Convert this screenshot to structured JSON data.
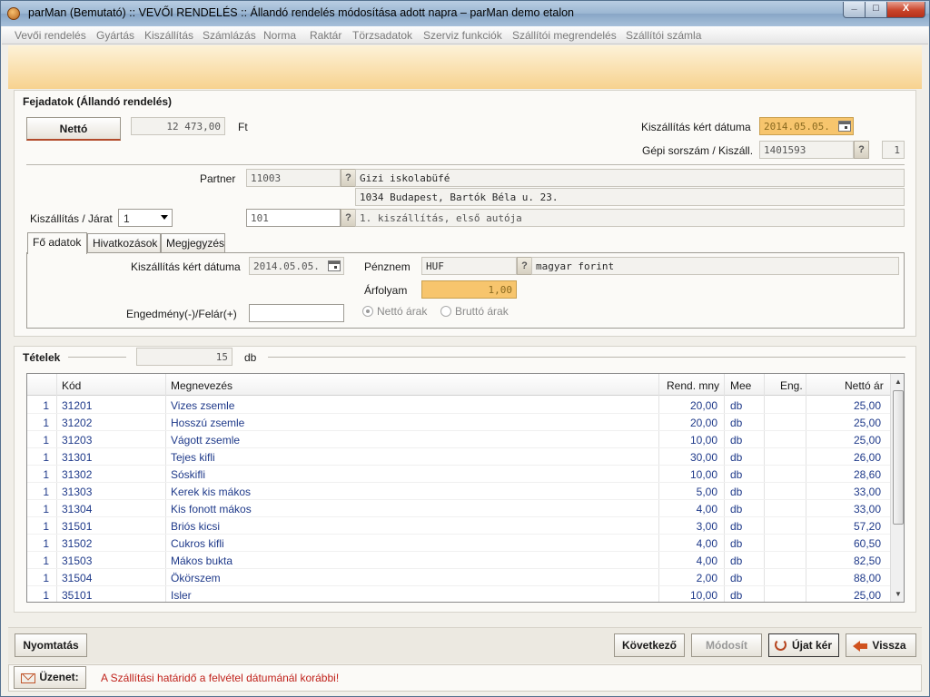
{
  "window": {
    "title": "parMan (Bemutató) :: VEVŐI RENDELÉS :: Állandó rendelés módosítása adott napra   –   parMan demo etalon",
    "min_glyph": "_",
    "max_glyph": "□",
    "close_glyph": "X"
  },
  "menu": [
    "Vevői rendelés",
    "Gyártás",
    "Kiszállítás",
    "Számlázás",
    "Norma",
    "Raktár",
    "Törzsadatok",
    "Szerviz funkciók",
    "Szállítói megrendelés",
    "Szállítói számla"
  ],
  "header": {
    "section_title": "Fejadatok (Állandó rendelés)",
    "netto_button": "Nettó",
    "netto_value": "12 473,00",
    "currency_unit": "Ft",
    "delivery_date_label": "Kiszállítás kért dátuma",
    "delivery_date": "2014.05.05.",
    "serial_label": "Gépi sorszám / Kiszáll.",
    "serial_value": "1401593",
    "serial_q": "?",
    "serial_count": "1",
    "partner_label": "Partner",
    "partner_code": "11003",
    "partner_q": "?",
    "partner_name": "Gizi iskolabüfé",
    "partner_address": "1034 Budapest, Bartók Béla u. 23.",
    "route_label": "Kiszállítás / Járat",
    "route_select": "1",
    "route_code": "101",
    "route_q": "?",
    "route_name": "1. kiszállítás, első autója"
  },
  "tabs": [
    "Fő adatok",
    "Hivatkozások",
    "Megjegyzés"
  ],
  "main_tab": {
    "delivery_date_label": "Kiszállítás kért dátuma",
    "delivery_date": "2014.05.05.",
    "discount_label": "Engedmény(-)/Felár(+)",
    "discount_value": "",
    "currency_label": "Pénznem",
    "currency_code": "HUF",
    "currency_q": "?",
    "currency_name": "magyar forint",
    "rate_label": "Árfolyam",
    "rate_value": "1,00",
    "radio_net": "Nettó árak",
    "radio_gross": "Bruttó árak"
  },
  "items": {
    "label": "Tételek",
    "count": "15",
    "unit": "db",
    "columns": [
      "Kód",
      "Megnevezés",
      "Rend. mny",
      "Mee",
      "Eng.",
      "Nettó ár"
    ],
    "rows": [
      {
        "n": "1",
        "code": "31201",
        "name": "Vizes zsemle",
        "qty": "20,00",
        "unit": "db",
        "eng": "",
        "price": "25,00"
      },
      {
        "n": "1",
        "code": "31202",
        "name": "Hosszú zsemle",
        "qty": "20,00",
        "unit": "db",
        "eng": "",
        "price": "25,00"
      },
      {
        "n": "1",
        "code": "31203",
        "name": "Vágott zsemle",
        "qty": "10,00",
        "unit": "db",
        "eng": "",
        "price": "25,00"
      },
      {
        "n": "1",
        "code": "31301",
        "name": "Tejes kifli",
        "qty": "30,00",
        "unit": "db",
        "eng": "",
        "price": "26,00"
      },
      {
        "n": "1",
        "code": "31302",
        "name": "Sóskifli",
        "qty": "10,00",
        "unit": "db",
        "eng": "",
        "price": "28,60"
      },
      {
        "n": "1",
        "code": "31303",
        "name": "Kerek kis mákos",
        "qty": "5,00",
        "unit": "db",
        "eng": "",
        "price": "33,00"
      },
      {
        "n": "1",
        "code": "31304",
        "name": "Kis fonott mákos",
        "qty": "4,00",
        "unit": "db",
        "eng": "",
        "price": "33,00"
      },
      {
        "n": "1",
        "code": "31501",
        "name": "Briós kicsi",
        "qty": "3,00",
        "unit": "db",
        "eng": "",
        "price": "57,20"
      },
      {
        "n": "1",
        "code": "31502",
        "name": "Cukros kifli",
        "qty": "4,00",
        "unit": "db",
        "eng": "",
        "price": "60,50"
      },
      {
        "n": "1",
        "code": "31503",
        "name": "Mákos bukta",
        "qty": "4,00",
        "unit": "db",
        "eng": "",
        "price": "82,50"
      },
      {
        "n": "1",
        "code": "31504",
        "name": "Ökörszem",
        "qty": "2,00",
        "unit": "db",
        "eng": "",
        "price": "88,00"
      },
      {
        "n": "1",
        "code": "35101",
        "name": "Isler",
        "qty": "10,00",
        "unit": "db",
        "eng": "",
        "price": "25,00"
      }
    ]
  },
  "buttons": {
    "print": "Nyomtatás",
    "next": "Következő",
    "modify": "Módosít",
    "new": "Újat kér",
    "back": "Vissza"
  },
  "message": {
    "label": "Üzenet:",
    "text": "A Szállítási határidő a felvétel dátumánál korábbi!"
  },
  "colors": {
    "message_text": "#c0221b",
    "highlight_field": "#f7c56d",
    "table_text": "#1f3a8a"
  }
}
